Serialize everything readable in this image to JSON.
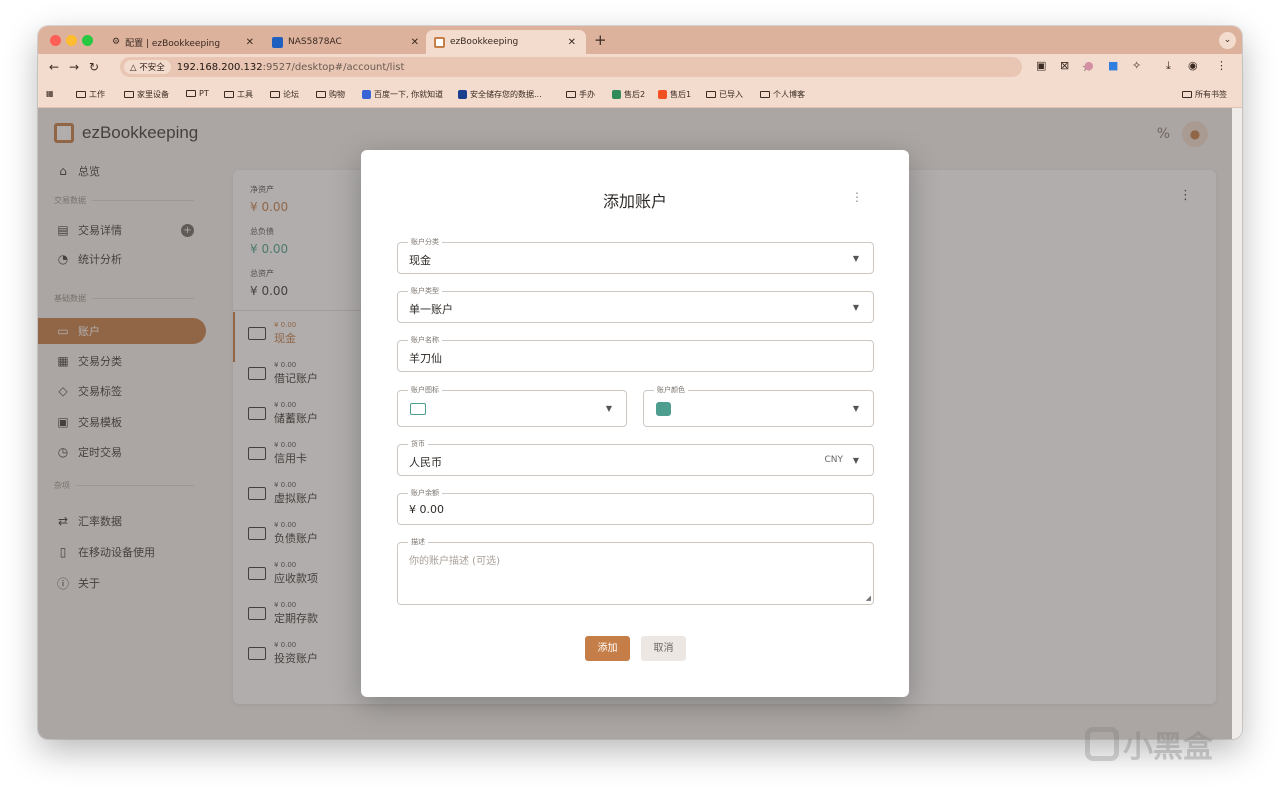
{
  "browser": {
    "tabs": [
      {
        "title": "配置 | ezBookkeeping",
        "icon": "gear-icon",
        "active": false
      },
      {
        "title": "NAS5878AC",
        "icon": "nas-icon",
        "active": false
      },
      {
        "title": "ezBookkeeping",
        "icon": "ezbookkeeping-icon",
        "active": true
      }
    ],
    "new_tab": "+",
    "address": {
      "security": "△ 不安全",
      "host": "192.168.200.132",
      "path": ":9527/desktop#/account/list"
    },
    "bookmarks": [
      "工作",
      "家里设备",
      "PT",
      "工具",
      "论坛",
      "购物",
      "百度一下, 你就知道",
      "安全储存您的数据...",
      "手办",
      "售后2",
      "售后1",
      "已导入",
      "个人博客"
    ],
    "all_bookmarks": "所有书签"
  },
  "app": {
    "name": "ezBookkeeping",
    "sidebar": {
      "overview": "总览",
      "sections": [
        "交易数据",
        "基础数据",
        "杂项"
      ],
      "items": [
        "交易详情",
        "统计分析",
        "账户",
        "交易分类",
        "交易标签",
        "交易模板",
        "定时交易",
        "汇率数据",
        "在移动设备使用",
        "关于"
      ]
    },
    "summary": [
      {
        "label": "净资产",
        "value": "¥ 0.00"
      },
      {
        "label": "总负债",
        "value": "¥ 0.00"
      },
      {
        "label": "总资产",
        "value": "¥ 0.00"
      }
    ],
    "accounts": [
      {
        "amount": "¥ 0.00",
        "name": "现金"
      },
      {
        "amount": "¥ 0.00",
        "name": "借记账户"
      },
      {
        "amount": "¥ 0.00",
        "name": "储蓄账户"
      },
      {
        "amount": "¥ 0.00",
        "name": "信用卡"
      },
      {
        "amount": "¥ 0.00",
        "name": "虚拟账户"
      },
      {
        "amount": "¥ 0.00",
        "name": "负债账户"
      },
      {
        "amount": "¥ 0.00",
        "name": "应收款项"
      },
      {
        "amount": "¥ 0.00",
        "name": "定期存款"
      },
      {
        "amount": "¥ 0.00",
        "name": "投资账户"
      }
    ]
  },
  "dialog": {
    "title": "添加账户",
    "category": {
      "label": "账户分类",
      "value": "现金"
    },
    "type": {
      "label": "账户类型",
      "value": "单一账户"
    },
    "name": {
      "label": "账户名称",
      "value": "羊刀仙"
    },
    "icon": {
      "label": "账户图标"
    },
    "color": {
      "label": "账户颜色",
      "value": "#4e9e8f"
    },
    "currency": {
      "label": "货币",
      "value": "人民币",
      "code": "CNY"
    },
    "balance": {
      "label": "账户余额",
      "value": "¥ 0.00"
    },
    "description": {
      "label": "描述",
      "placeholder": "你的账户描述 (可选)"
    },
    "add_button": "添加",
    "cancel_button": "取消"
  },
  "watermark": "小黑盒",
  "colors": {
    "accent": "#c67e48",
    "teal": "#4e9e8f",
    "tabbar": "#dcb29c"
  }
}
